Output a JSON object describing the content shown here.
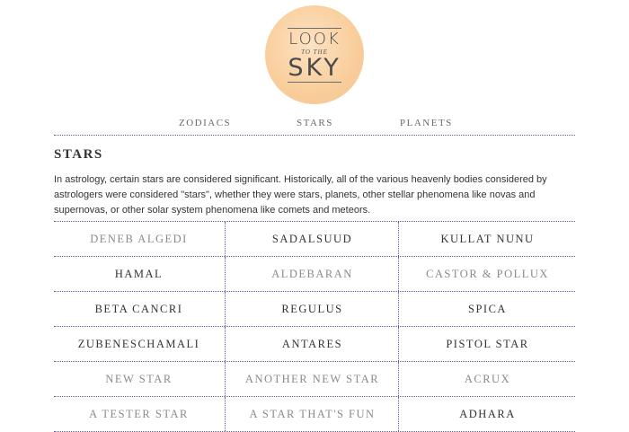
{
  "logo": {
    "line1": "LOOK",
    "line2": "TO THE",
    "line3": "SKY"
  },
  "nav": {
    "items": [
      "ZODIACS",
      "STARS",
      "PLANETS"
    ]
  },
  "page": {
    "title": "STARS",
    "intro": "In astrology, certain stars are considered significant. Historically, all of the various heavenly bodies considered by astrologers were considered \"stars\", whether they were stars, planets, other stellar phenomena like novas and supernovas, or other solar system phenomena like comets and meteors."
  },
  "stars": [
    [
      {
        "label": "DENEB ALGEDI",
        "tone": "light"
      },
      {
        "label": "SADALSUUD",
        "tone": "dark"
      },
      {
        "label": "KULLAT NUNU",
        "tone": "dark"
      }
    ],
    [
      {
        "label": "HAMAL",
        "tone": "dark"
      },
      {
        "label": "ALDEBARAN",
        "tone": "light"
      },
      {
        "label": "CASTOR & POLLUX",
        "tone": "light"
      }
    ],
    [
      {
        "label": "BETA CANCRI",
        "tone": "dark"
      },
      {
        "label": "REGULUS",
        "tone": "dark"
      },
      {
        "label": "SPICA",
        "tone": "dark"
      }
    ],
    [
      {
        "label": "ZUBENESCHAMALI",
        "tone": "dark"
      },
      {
        "label": "ANTARES",
        "tone": "dark"
      },
      {
        "label": "PISTOL STAR",
        "tone": "dark"
      }
    ],
    [
      {
        "label": "NEW STAR",
        "tone": "light"
      },
      {
        "label": "ANOTHER NEW STAR",
        "tone": "light"
      },
      {
        "label": "ACRUX",
        "tone": "light"
      }
    ],
    [
      {
        "label": "A TESTER STAR",
        "tone": "light"
      },
      {
        "label": "A STAR THAT'S FUN",
        "tone": "light"
      },
      {
        "label": "ADHARA",
        "tone": "dark"
      }
    ]
  ],
  "colors": {
    "rule": "#5b5ba6",
    "dark_text": "#333333",
    "light_text": "#8a8a8a",
    "logo": "#f9cf9e"
  }
}
